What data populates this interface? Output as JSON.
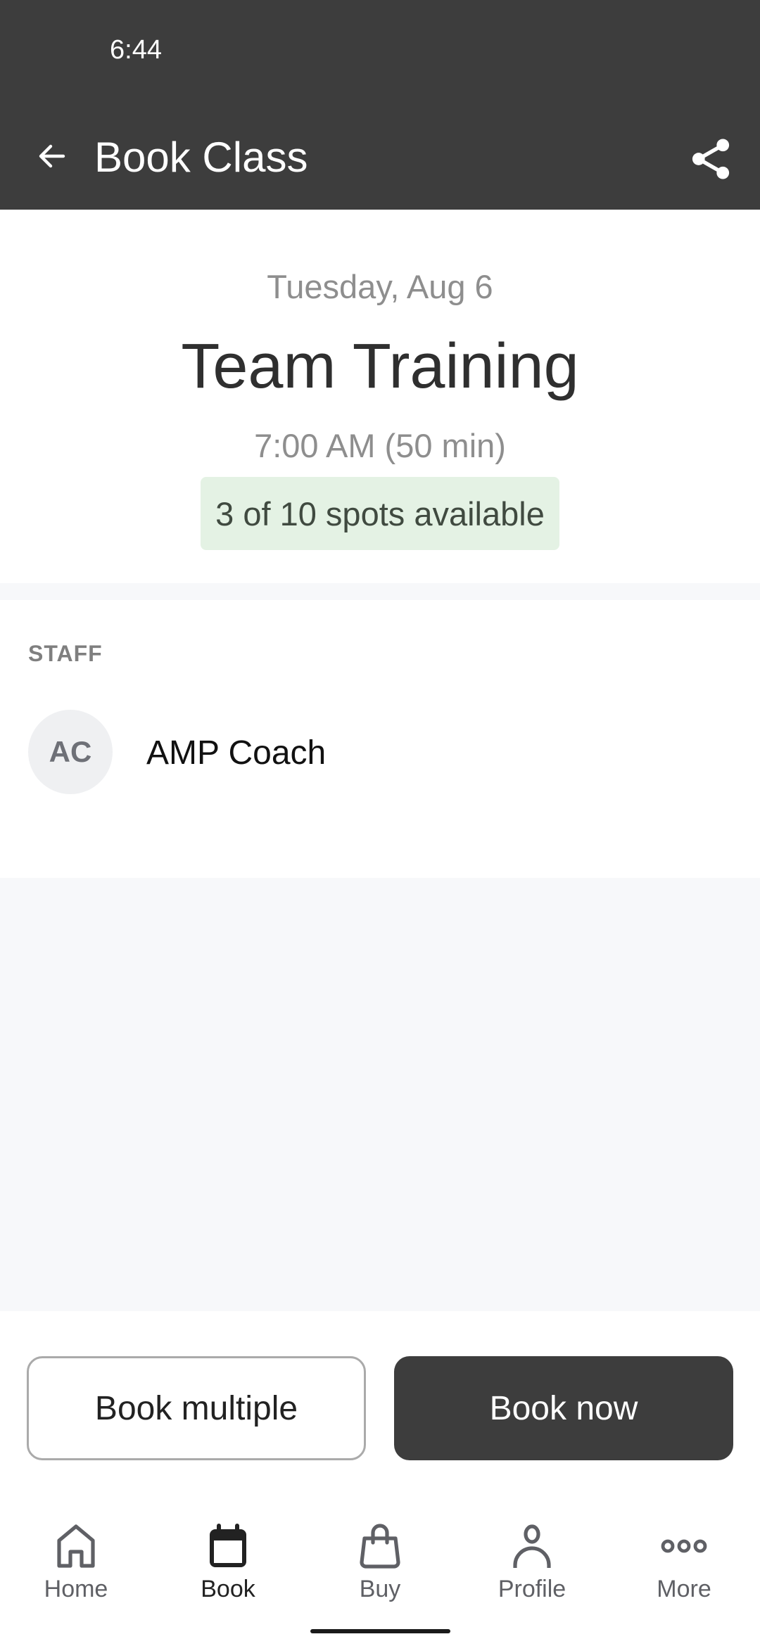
{
  "status_bar": {
    "time": "6:44"
  },
  "app_bar": {
    "title": "Book Class",
    "back_icon": "arrow-left-icon",
    "share_icon": "share-icon"
  },
  "class_info": {
    "date": "Tuesday, Aug 6",
    "title": "Team Training",
    "time": "7:00 AM (50 min)",
    "spots": {
      "label": "3 of 10 spots available",
      "available": 3,
      "total": 10
    }
  },
  "staff": {
    "section_label": "STAFF",
    "members": [
      {
        "initials": "AC",
        "name": "AMP Coach"
      }
    ]
  },
  "actions": {
    "book_multiple": "Book multiple",
    "book_now": "Book now"
  },
  "bottom_nav": {
    "active": "Book",
    "items": [
      {
        "label": "Home",
        "icon": "home-icon"
      },
      {
        "label": "Book",
        "icon": "calendar-icon"
      },
      {
        "label": "Buy",
        "icon": "shopping-bag-icon"
      },
      {
        "label": "Profile",
        "icon": "person-icon"
      },
      {
        "label": "More",
        "icon": "more-dots-icon"
      }
    ]
  },
  "colors": {
    "header_bg": "#3d3d3d",
    "badge_bg": "#e4f2e4",
    "primary_button": "#3d3d3d",
    "page_gray": "#f7f8fa"
  }
}
